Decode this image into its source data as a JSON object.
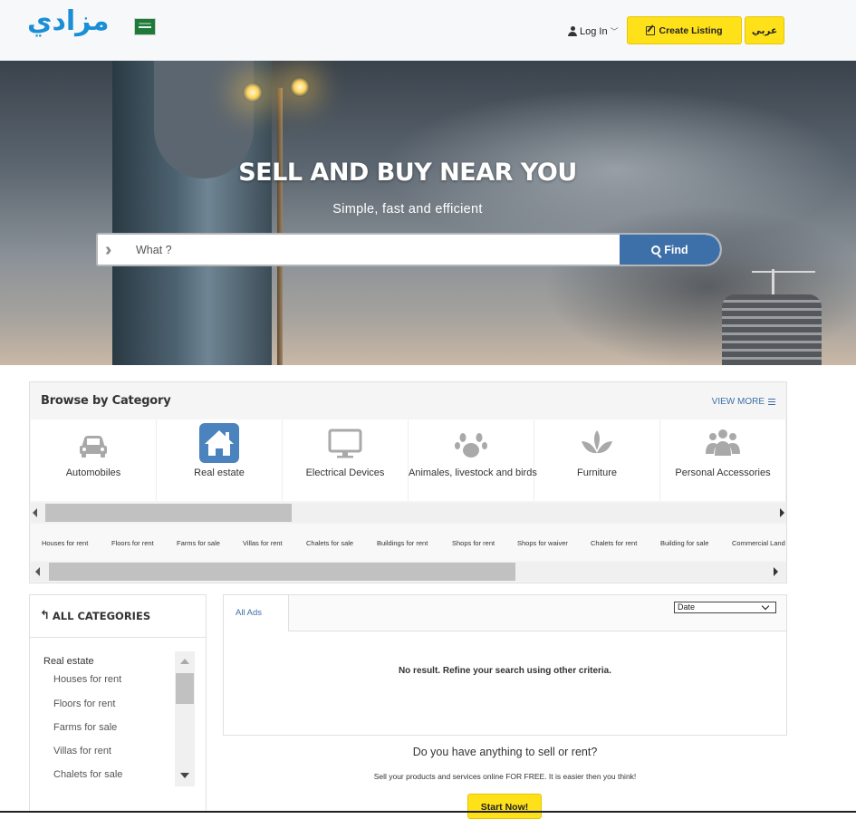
{
  "header": {
    "logo_text": "مزادي",
    "login_label": "Log In",
    "create_listing_label": "Create Listing",
    "language_label": "عربي"
  },
  "hero": {
    "title": "SELL AND BUY NEAR YOU",
    "subtitle": "Simple, fast and efficient",
    "search_placeholder": "What ?",
    "find_label": "Find"
  },
  "browse": {
    "title": "Browse by Category",
    "view_more_label": "VIEW MORE",
    "categories": [
      {
        "label": "Automobiles",
        "icon": "car-icon"
      },
      {
        "label": "Real estate",
        "icon": "home-icon",
        "active": true
      },
      {
        "label": "Electrical Devices",
        "icon": "monitor-icon"
      },
      {
        "label": "Animales, livestock and birds",
        "icon": "paw-icon"
      },
      {
        "label": "Furniture",
        "icon": "lotus-icon"
      },
      {
        "label": "Personal Accessories",
        "icon": "users-icon"
      }
    ],
    "tags": [
      "Houses for rent",
      "Floors for rent",
      "Farms for sale",
      "Villas for rent",
      "Chalets for sale",
      "Buildings for rent",
      "Shops for rent",
      "Shops for waiver",
      "Chalets for rent",
      "Building for sale",
      "Commercial Land"
    ]
  },
  "sidebar": {
    "heading": "ALL CATEGORIES",
    "parent": "Real estate",
    "items": [
      "Houses for rent",
      "Floors for rent",
      "Farms for sale",
      "Villas for rent",
      "Chalets for sale"
    ]
  },
  "results": {
    "tab_label": "All Ads",
    "sort_value": "Date",
    "empty_message": "No result. Refine your search using other criteria."
  },
  "cta": {
    "question": "Do you have anything to sell or rent?",
    "subtitle": "Sell your products and services online FOR FREE. It is easier then you think!",
    "button_label": "Start Now!"
  },
  "colors": {
    "accent_yellow": "#ffe11a",
    "primary_blue": "#3d6fa8",
    "logo_blue": "#1a8fd6"
  }
}
